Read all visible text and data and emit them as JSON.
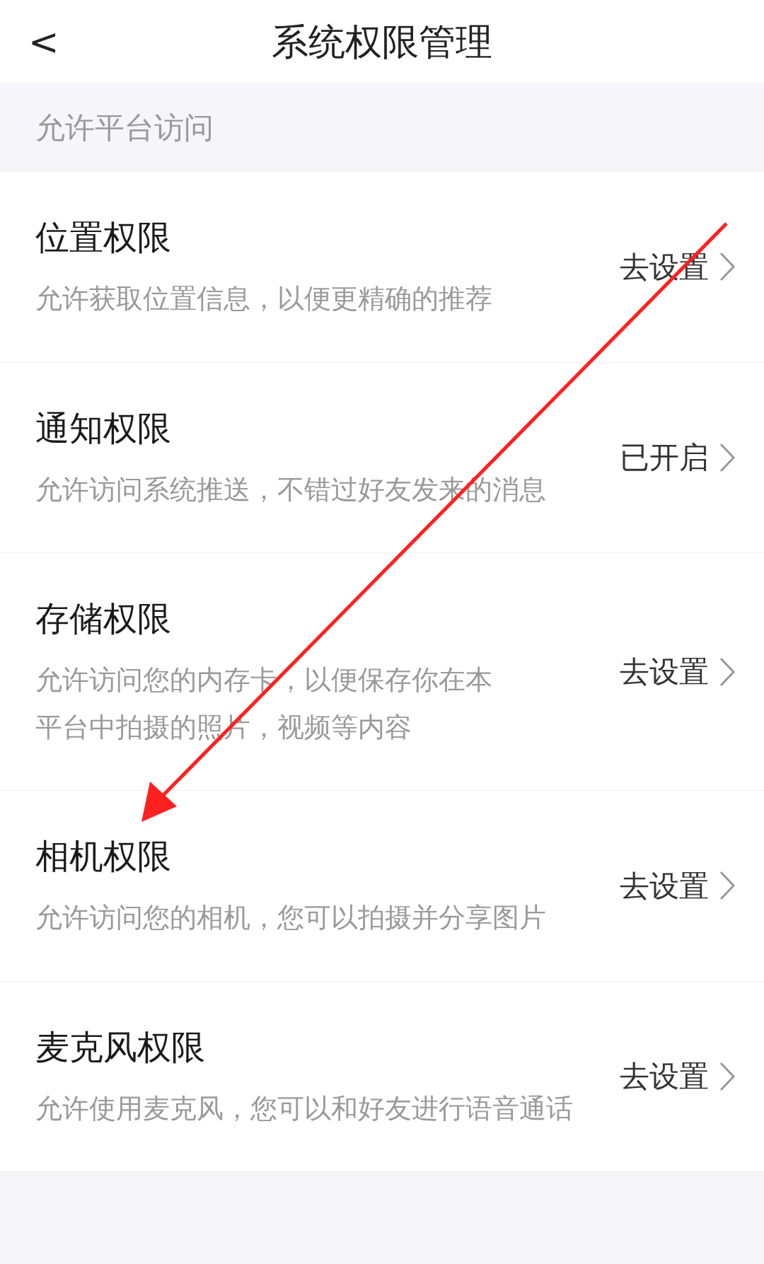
{
  "header": {
    "back": "<",
    "title": "系统权限管理"
  },
  "section_title": "允许平台访问",
  "permissions": [
    {
      "title": "位置权限",
      "description": "允许获取位置信息，以便更精确的推荐",
      "action": "去设置"
    },
    {
      "title": "通知权限",
      "description": "允许访问系统推送，不错过好友发来的消息",
      "action": "已开启"
    },
    {
      "title": "存储权限",
      "description": "允许访问您的内存卡，以便保存你在本平台中拍摄的照片，视频等内容",
      "action": "去设置"
    },
    {
      "title": "相机权限",
      "description": "允许访问您的相机，您可以拍摄并分享图片",
      "action": "去设置"
    },
    {
      "title": "麦克风权限",
      "description": "允许使用麦克风，您可以和好友进行语音通话",
      "action": "去设置"
    }
  ]
}
